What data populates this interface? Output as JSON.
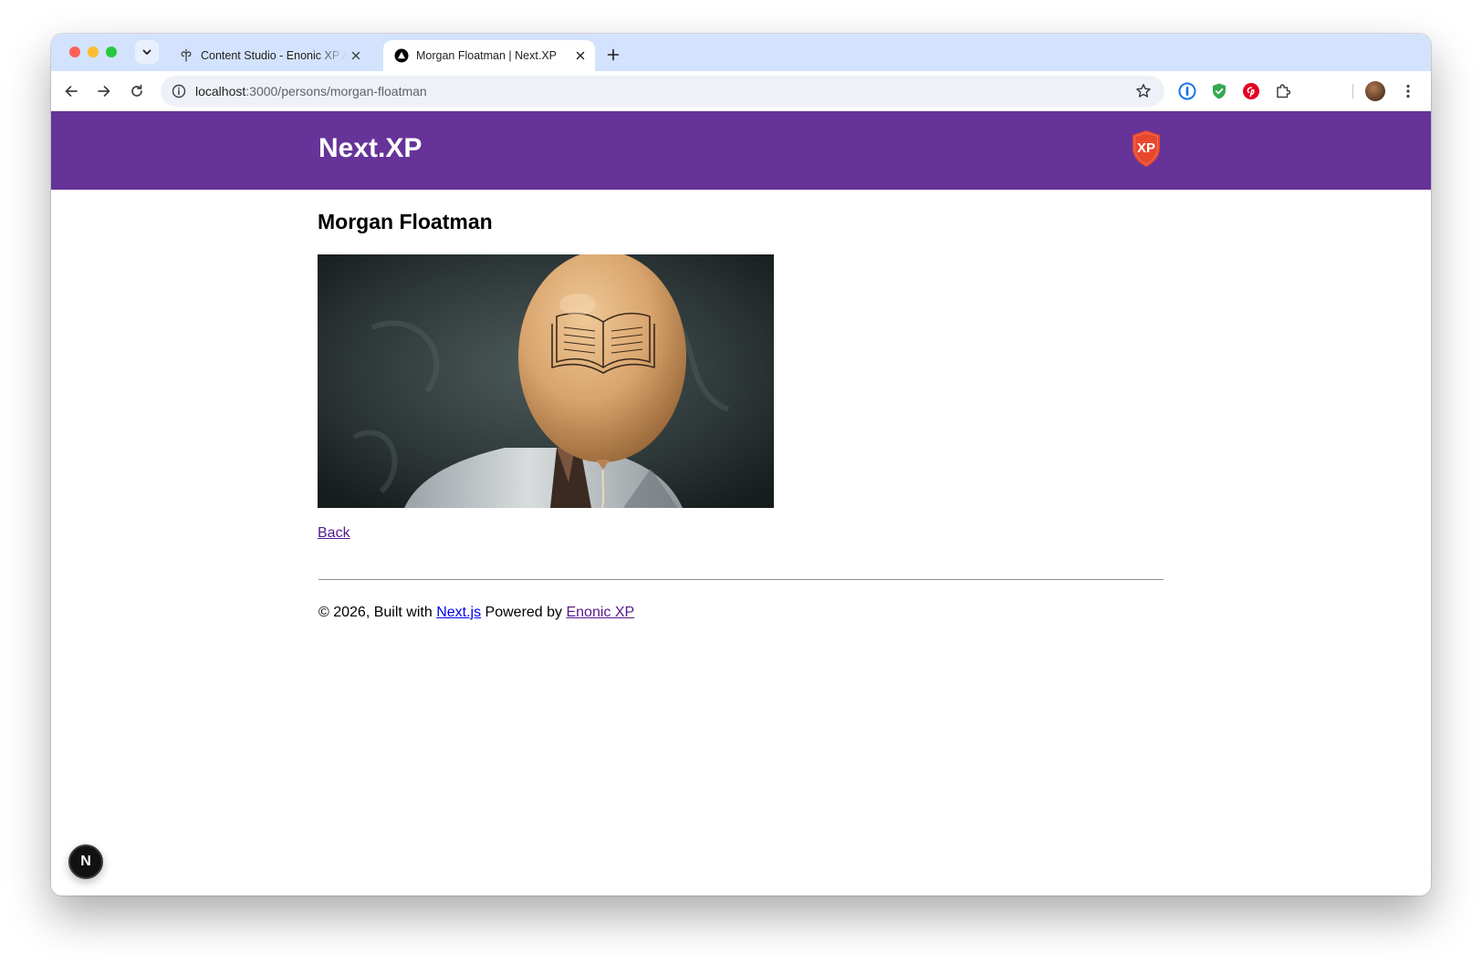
{
  "browser": {
    "tabs": [
      {
        "title": "Content Studio - Enonic XP Admin",
        "active": false
      },
      {
        "title": "Morgan Floatman | Next.XP",
        "active": true
      }
    ],
    "url": {
      "host": "localhost",
      "path": ":3000/persons/morgan-floatman"
    },
    "colors": {
      "tabstrip": "#d3e3fd",
      "omnibox": "#eef1f8"
    },
    "extensions": [
      "onepassword-icon",
      "shield-check-icon",
      "pinterest-icon",
      "puzzle-extensions-icon"
    ]
  },
  "site": {
    "title": "Next.XP",
    "logo_text": "XP",
    "colors": {
      "header": "#663399",
      "logo": "#e8472e"
    }
  },
  "person": {
    "name": "Morgan Floatman",
    "photo_description": "man with a tan balloon covering his face, balloon has an open book drawing",
    "back_label": "Back"
  },
  "footer": {
    "prefix": "© 2026, Built with ",
    "nextjs_label": "Next.js",
    "middle": " Powered by ",
    "enonic_label": "Enonic XP"
  },
  "dev_indicator": {
    "label": "N"
  }
}
